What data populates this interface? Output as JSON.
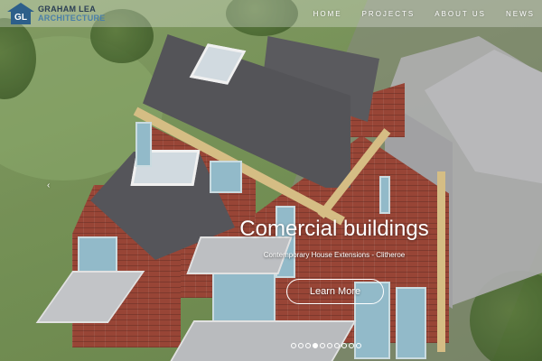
{
  "brand": {
    "logo_initials": "GL",
    "line1": "GRAHAM LEA",
    "line2": "ARCHITECTURE",
    "colors": {
      "primary": "#2d5f8a",
      "secondary": "#4a7fa8"
    }
  },
  "nav": {
    "items": [
      {
        "label": "HOME"
      },
      {
        "label": "PROJECTS"
      },
      {
        "label": "ABOUT US"
      },
      {
        "label": "NEWS"
      }
    ]
  },
  "carousel": {
    "title": "Comercial buildings",
    "subtitle": "Contemporary House Extensions - Clitheroe",
    "button_label": "Learn More",
    "prev_arrow_icon": "chevron-left-icon",
    "prev_arrow_glyph": "‹",
    "slide_count": 10,
    "active_index": 3
  }
}
